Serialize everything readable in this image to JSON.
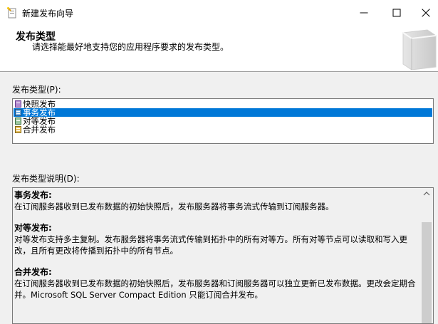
{
  "window": {
    "title": "新建发布向导",
    "icon": "wizard-icon"
  },
  "header": {
    "title": "发布类型",
    "subtitle": "请选择能最好地支持您的应用程序要求的发布类型。"
  },
  "publication_types": {
    "label": "发布类型(P):",
    "items": [
      {
        "label": "快照发布",
        "icon": "snapshot-icon",
        "selected": false
      },
      {
        "label": "事务发布",
        "icon": "transactional-icon",
        "selected": true
      },
      {
        "label": "对等发布",
        "icon": "peer-to-peer-icon",
        "selected": false
      },
      {
        "label": "合并发布",
        "icon": "merge-icon",
        "selected": false
      }
    ]
  },
  "description": {
    "label": "发布类型说明(D):",
    "sections": [
      {
        "heading": "事务发布:",
        "text": "在订阅服务器收到已发布数据的初始快照后，发布服务器将事务流式传输到订阅服务器。"
      },
      {
        "heading": "对等发布:",
        "text": "对等发布支持多主复制。发布服务器将事务流式传输到拓扑中的所有对等方。所有对等节点可以读取和写入更改，且所有更改将传播到拓扑中的所有节点。"
      },
      {
        "heading": "合并发布:",
        "text": "在订阅服务器收到已发布数据的初始快照后，发布服务器和订阅服务器可以独立更新已发布数据。更改会定期合并。Microsoft SQL Server Compact Edition 只能订阅合并发布。"
      }
    ]
  },
  "colors": {
    "selection": "#0078d7",
    "window_bg": "#f0f0f0"
  }
}
